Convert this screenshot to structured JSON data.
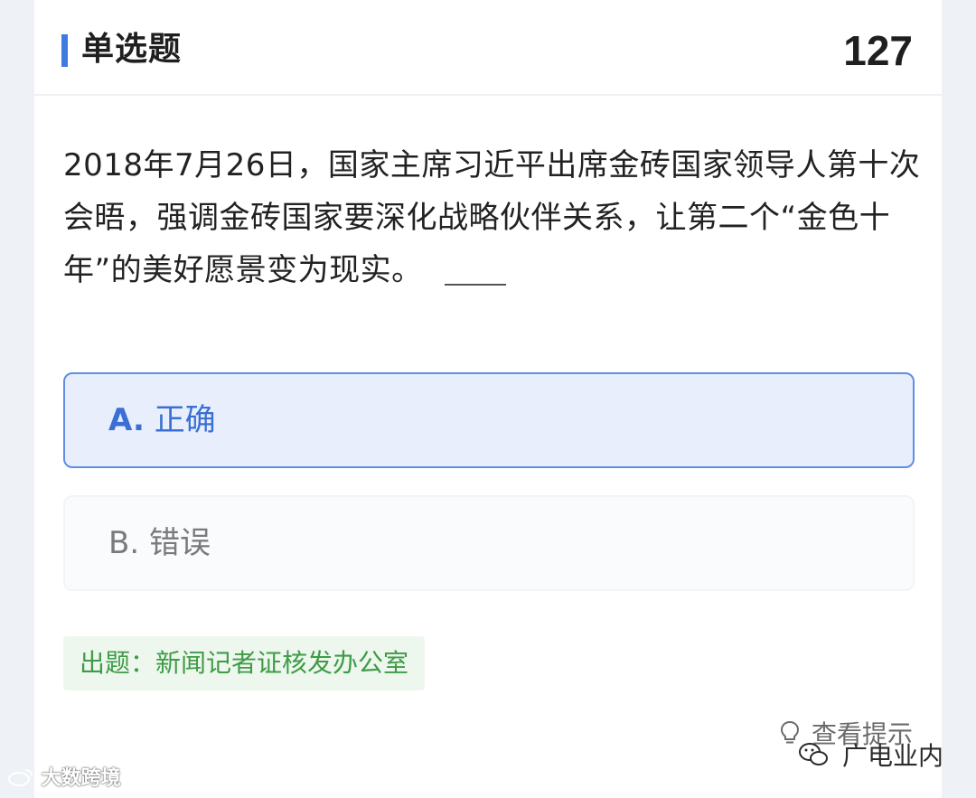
{
  "header": {
    "title": "单选题",
    "question_number": "127"
  },
  "question": {
    "text": "2018年7月26日，国家主席习近平出席金砖国家领导人第十次会晤，强调金砖国家要深化战略伙伴关系，让第二个“金色十年”的美好愿景变为现实。"
  },
  "options": [
    {
      "letter": "A.",
      "label": "正确",
      "selected": true
    },
    {
      "letter": "B.",
      "label": "错误",
      "selected": false
    }
  ],
  "source": {
    "label": "出题：新闻记者证核发办公室"
  },
  "hint": {
    "label": "查看提示",
    "icon": "lightbulb-icon"
  },
  "watermarks": {
    "left": "大数跨境",
    "right": "广电业内"
  },
  "colors": {
    "accent": "#3d7be0",
    "selected_bg": "#e8eefc",
    "selected_border": "#5e8ee6",
    "source_green": "#3f9b47",
    "source_bg": "#edf7ed"
  }
}
